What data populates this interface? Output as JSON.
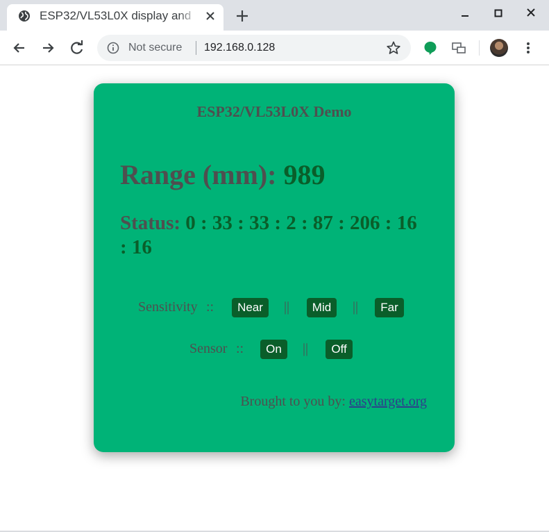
{
  "browser": {
    "tab_title": "ESP32/VL53L0X display and",
    "new_tab_symbol": "+",
    "security_label": "Not secure",
    "url": "192.168.0.128",
    "icons": [
      "globe-icon",
      "close-icon",
      "back-arrow-icon",
      "forward-arrow-icon",
      "reload-icon",
      "info-icon",
      "star-icon",
      "extension-icon",
      "cast-icon",
      "avatar",
      "menu-dots-icon"
    ]
  },
  "page": {
    "title": "ESP32/VL53L0X Demo",
    "range_label": "Range (mm):",
    "range_value": "989",
    "status_label": "Status:",
    "status_value": "0 : 33 : 33 : 2 : 87 : 206 : 16 : 16",
    "sensitivity": {
      "label": "Sensitivity",
      "separator": "::",
      "pipe": "||",
      "near": "Near",
      "mid": "Mid",
      "far": "Far"
    },
    "sensor": {
      "label": "Sensor",
      "separator": "::",
      "pipe": "||",
      "on": "On",
      "off": "Off"
    },
    "credit_text": "Brought to you by:",
    "credit_link": "easytarget.org",
    "colors": {
      "card": "#00b377",
      "button": "#0a5e2a",
      "value_text": "#0a5e2a",
      "label_text": "#4f4f4f",
      "link": "#2d3f8c"
    }
  }
}
